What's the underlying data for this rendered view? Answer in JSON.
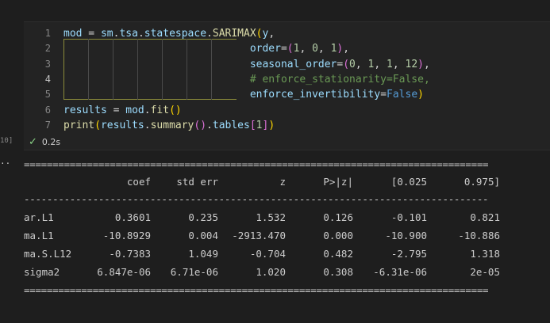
{
  "editor": {
    "line_numbers": [
      "1",
      "2",
      "3",
      "4",
      "5",
      "6",
      "7"
    ],
    "active_line": "4",
    "lines": [
      [
        {
          "t": "mod",
          "c": "var"
        },
        {
          "t": " = ",
          "c": "plain"
        },
        {
          "t": "sm",
          "c": "var"
        },
        {
          "t": ".",
          "c": "plain"
        },
        {
          "t": "tsa",
          "c": "var"
        },
        {
          "t": ".",
          "c": "plain"
        },
        {
          "t": "statespace",
          "c": "var"
        },
        {
          "t": ".",
          "c": "plain"
        },
        {
          "t": "SARIMAX",
          "c": "fn"
        },
        {
          "t": "(",
          "c": "bracket"
        },
        {
          "t": "y",
          "c": "var"
        },
        {
          "t": ",",
          "c": "plain"
        }
      ],
      [
        {
          "t": "                              ",
          "c": "plain"
        },
        {
          "t": "order",
          "c": "var"
        },
        {
          "t": "=",
          "c": "plain"
        },
        {
          "t": "(",
          "c": "paren2"
        },
        {
          "t": "1",
          "c": "num"
        },
        {
          "t": ", ",
          "c": "plain"
        },
        {
          "t": "0",
          "c": "num"
        },
        {
          "t": ", ",
          "c": "plain"
        },
        {
          "t": "1",
          "c": "num"
        },
        {
          "t": ")",
          "c": "paren2"
        },
        {
          "t": ",",
          "c": "plain"
        }
      ],
      [
        {
          "t": "                              ",
          "c": "plain"
        },
        {
          "t": "seasonal_order",
          "c": "var"
        },
        {
          "t": "=",
          "c": "plain"
        },
        {
          "t": "(",
          "c": "paren2"
        },
        {
          "t": "0",
          "c": "num"
        },
        {
          "t": ", ",
          "c": "plain"
        },
        {
          "t": "1",
          "c": "num"
        },
        {
          "t": ", ",
          "c": "plain"
        },
        {
          "t": "1",
          "c": "num"
        },
        {
          "t": ", ",
          "c": "plain"
        },
        {
          "t": "12",
          "c": "num"
        },
        {
          "t": ")",
          "c": "paren2"
        },
        {
          "t": ",",
          "c": "plain"
        }
      ],
      [
        {
          "t": "                              ",
          "c": "plain"
        },
        {
          "t": "# enforce_stationarity=False,",
          "c": "comment"
        }
      ],
      [
        {
          "t": "                              ",
          "c": "plain"
        },
        {
          "t": "enforce_invertibility",
          "c": "var"
        },
        {
          "t": "=",
          "c": "plain"
        },
        {
          "t": "False",
          "c": "kw"
        },
        {
          "t": ")",
          "c": "bracket"
        }
      ],
      [
        {
          "t": "results",
          "c": "var"
        },
        {
          "t": " = ",
          "c": "plain"
        },
        {
          "t": "mod",
          "c": "var"
        },
        {
          "t": ".",
          "c": "plain"
        },
        {
          "t": "fit",
          "c": "fn"
        },
        {
          "t": "()",
          "c": "bracket"
        }
      ],
      [
        {
          "t": "print",
          "c": "fn"
        },
        {
          "t": "(",
          "c": "bracket"
        },
        {
          "t": "results",
          "c": "var"
        },
        {
          "t": ".",
          "c": "plain"
        },
        {
          "t": "summary",
          "c": "fn"
        },
        {
          "t": "()",
          "c": "paren2"
        },
        {
          "t": ".",
          "c": "plain"
        },
        {
          "t": "tables",
          "c": "var"
        },
        {
          "t": "[",
          "c": "paren2"
        },
        {
          "t": "1",
          "c": "num"
        },
        {
          "t": "]",
          "c": "paren2"
        },
        {
          "t": ")",
          "c": "bracket"
        }
      ]
    ]
  },
  "cell": {
    "execution_count": "10]",
    "status_icon": "check-icon",
    "duration": "0.2s",
    "output_marker": ".."
  },
  "output": {
    "rule_double": "=================================================================================",
    "rule_single": "---------------------------------------------------------------------------------",
    "headers": [
      "",
      "coef",
      "std err",
      "z",
      "P>|z|",
      "[0.025",
      "0.975]"
    ],
    "rows": [
      [
        "ar.L1",
        "0.3601",
        "0.235",
        "1.532",
        "0.126",
        "-0.101",
        "0.821"
      ],
      [
        "ma.L1",
        "-10.8929",
        "0.004",
        "-2913.470",
        "0.000",
        "-10.900",
        "-10.886"
      ],
      [
        "ma.S.L12",
        "-0.7383",
        "1.049",
        "-0.704",
        "0.482",
        "-2.795",
        "1.318"
      ],
      [
        "sigma2",
        "6.847e-06",
        "6.71e-06",
        "1.020",
        "0.308",
        "-6.31e-06",
        "2e-05"
      ]
    ]
  },
  "colors": {
    "background": "#1e1e1e",
    "cell_background": "#232323",
    "success": "#89d185"
  }
}
